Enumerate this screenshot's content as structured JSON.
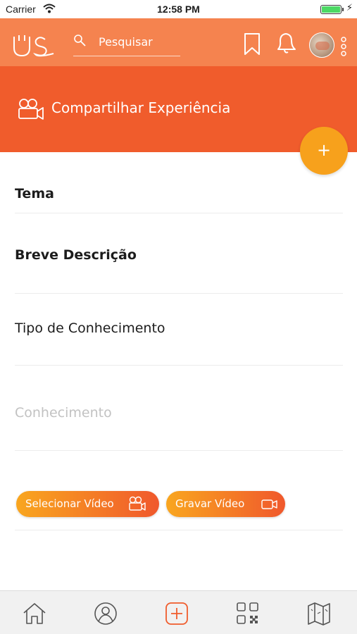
{
  "status_bar": {
    "carrier": "Carrier",
    "time": "12:58 PM",
    "battery_level": 1.0,
    "battery_color": "#4cd964",
    "icons": [
      "wifi-icon",
      "battery-icon",
      "charging-icon"
    ]
  },
  "nav": {
    "logo_icon": "us-logo",
    "search_placeholder": "Pesquisar",
    "icons": [
      "search-icon",
      "bookmark-icon",
      "bell-icon",
      "avatar",
      "more-vertical-icon"
    ],
    "background_color": "#f5834f"
  },
  "header": {
    "title": "Compartilhar Experiência",
    "icon": "video-camera-icon",
    "background_color": "#f05c2c",
    "fab_label": "+",
    "fab_color": "#f7a11c"
  },
  "form": {
    "fields": [
      {
        "label": "Tema"
      },
      {
        "label": "Breve Descrição"
      },
      {
        "label": "Tipo de Conhecimento"
      },
      {
        "label": "Conhecimento"
      }
    ]
  },
  "buttons": {
    "select_video": "Selecionar Vídeo",
    "record_video": "Gravar Vídeo",
    "gradient_start": "#f9a61f",
    "gradient_end": "#f0582c"
  },
  "tabbar": {
    "tabs": [
      "home-icon",
      "profile-icon",
      "add-icon",
      "qr-code-icon",
      "map-icon"
    ],
    "active_tab": "add-icon",
    "active_color": "#f05c2c"
  }
}
